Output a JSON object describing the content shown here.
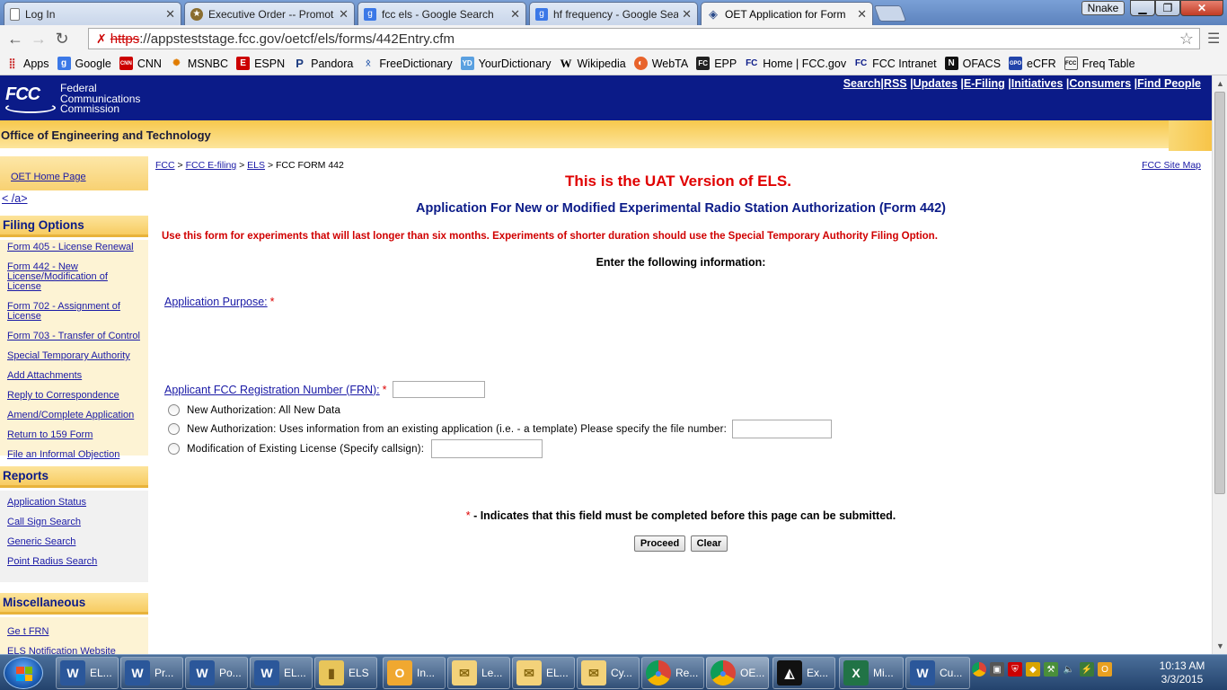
{
  "browser": {
    "tabs": [
      {
        "label": "Log In",
        "icon": "document-icon",
        "active": false
      },
      {
        "label": "Executive Order -- Promot",
        "icon": "seal-icon",
        "active": false
      },
      {
        "label": "fcc els - Google Search",
        "icon": "google-icon",
        "active": false
      },
      {
        "label": "hf frequency - Google Sea",
        "icon": "google-icon",
        "active": false
      },
      {
        "label": "OET Application for Form",
        "icon": "diamond-icon",
        "active": true
      }
    ],
    "profile_name": "Nnake",
    "url_scheme": "https",
    "url_rest": "://appsteststage.fcc.gov/oetcf/els/forms/442Entry.cfm",
    "bookmarks": [
      {
        "label": "Apps",
        "icon": "apps-grid-icon"
      },
      {
        "label": "Google",
        "icon": "google-icon"
      },
      {
        "label": "CNN",
        "icon": "cnn-icon"
      },
      {
        "label": "MSNBC",
        "icon": "peacock-icon"
      },
      {
        "label": "ESPN",
        "icon": "espn-icon"
      },
      {
        "label": "Pandora",
        "icon": "pandora-icon"
      },
      {
        "label": "FreeDictionary",
        "icon": "dictionary-icon"
      },
      {
        "label": "YourDictionary",
        "icon": "yd-icon"
      },
      {
        "label": "Wikipedia",
        "icon": "wikipedia-icon"
      },
      {
        "label": "WebTA",
        "icon": "webta-icon"
      },
      {
        "label": "EPP",
        "icon": "fcc-icon"
      },
      {
        "label": "Home | FCC.gov",
        "icon": "fcc-icon"
      },
      {
        "label": "FCC Intranet",
        "icon": "fcc-icon"
      },
      {
        "label": "OFACS",
        "icon": "ofacs-icon"
      },
      {
        "label": "eCFR",
        "icon": "gpo-icon"
      },
      {
        "label": "Freq Table",
        "icon": "freq-table-icon"
      }
    ]
  },
  "header": {
    "logo_text": "FCC",
    "agency_line1": "Federal",
    "agency_line2": "Communications",
    "agency_line3": "Commission",
    "nav": [
      "Search",
      "RSS",
      "Updates",
      "E-Filing",
      "Initiatives",
      "Consumers",
      "Find People"
    ],
    "office_title": "Office of Engineering and Technology"
  },
  "sidebar": {
    "home_link": "OET Home Page",
    "anchor_text": "< /a>",
    "sections": [
      {
        "title": "Filing Options",
        "items": [
          "Form 405 - License Renewal",
          "Form 442 - New License/Modification of License",
          "Form 702 - Assignment of License",
          "Form 703 - Transfer of Control",
          "Special Temporary Authority",
          "Add Attachments",
          "Reply to Correspondence",
          "Amend/Complete Application",
          "Return to 159 Form",
          "File an Informal Objection"
        ]
      },
      {
        "title": "Reports",
        "items": [
          "Application Status",
          "Call Sign Search",
          "Generic Search",
          "Point Radius Search"
        ]
      },
      {
        "title": "Miscellaneous",
        "items": [
          "Ge t FRN",
          "ELS Notification Website"
        ]
      }
    ]
  },
  "main": {
    "breadcrumb": {
      "fcc": "FCC",
      "efiling": "FCC E-filing",
      "els": "ELS",
      "current": "FCC FORM 442",
      "sep": ">"
    },
    "site_map": "FCC Site Map",
    "uat_notice": "This is the UAT Version of ELS.",
    "form_title": "Application For New or Modified Experimental Radio Station Authorization (Form 442)",
    "warning": "Use this form for experiments that will last longer than six months. Experiments of shorter duration should use the Special Temporary Authority Filing Option.",
    "enter_info": "Enter the following information:",
    "purpose_label": "Application Purpose:",
    "required_mark": "*",
    "options": [
      "New Authorization: All New Data",
      "New Authorization: Uses information from an existing application (i.e. - a template) Please specify the file number:",
      "Modification of Existing License (Specify callsign):"
    ],
    "frn_label": "Applicant FCC Registration Number (FRN):",
    "legend": " - Indicates that this field must be completed before this page can be submitted.",
    "proceed_label": "Proceed",
    "clear_label": "Clear"
  },
  "taskbar": {
    "items": [
      {
        "label": "EL...",
        "icon": "word-icon"
      },
      {
        "label": "Pr...",
        "icon": "word-icon"
      },
      {
        "label": "Po...",
        "icon": "word-icon"
      },
      {
        "label": "EL...",
        "icon": "word-icon"
      },
      {
        "label": "ELS",
        "icon": "folder-icon"
      },
      {
        "label": "In...",
        "icon": "outlook-icon"
      },
      {
        "label": "Le...",
        "icon": "mail-icon"
      },
      {
        "label": "EL...",
        "icon": "mail-icon"
      },
      {
        "label": "Cy...",
        "icon": "mail-icon"
      },
      {
        "label": "Re...",
        "icon": "chrome-icon"
      },
      {
        "label": "OE...",
        "icon": "chrome-icon"
      },
      {
        "label": "Ex...",
        "icon": "prism-icon"
      },
      {
        "label": "Mi...",
        "icon": "excel-icon"
      },
      {
        "label": "Cu...",
        "icon": "word-icon"
      }
    ],
    "time": "10:13 AM",
    "date": "3/3/2015"
  }
}
